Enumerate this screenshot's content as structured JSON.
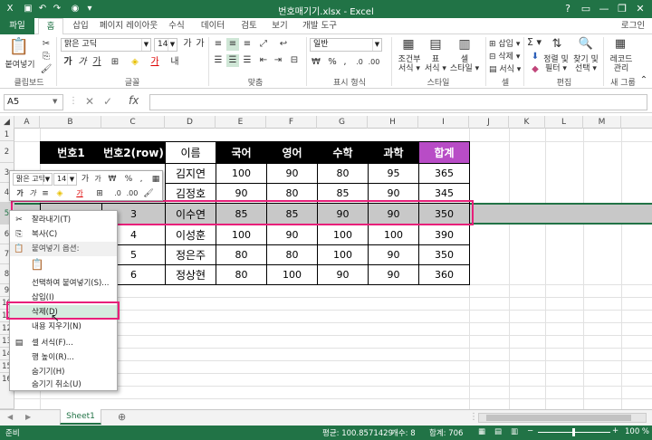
{
  "window": {
    "title": "번호매기기.xlsx - Excel",
    "user": "로그인"
  },
  "tabs": [
    "파일",
    "홈",
    "삽입",
    "페이지 레이아웃",
    "수식",
    "데이터",
    "검토",
    "보기",
    "개발 도구"
  ],
  "ribbon": {
    "paste": "붙여넣기",
    "font_name": "맑은 고딕",
    "font_size": "14",
    "number_format": "일반",
    "groups": {
      "clipboard": "클립보드",
      "font": "글꼴",
      "align": "맞춤",
      "number": "표시 형식",
      "style": "스타일",
      "cells": "셀",
      "edit": "편집",
      "newgroup": "새 그룹"
    },
    "cond_format": [
      "조건부",
      "서식 ▾"
    ],
    "table_format": [
      "표",
      "서식 ▾"
    ],
    "cell_style": [
      "셀",
      "스타일 ▾"
    ],
    "insert": "삽입 ▾",
    "delete": "삭제 ▾",
    "format": "서식 ▾",
    "sort": [
      "정렬 및",
      "필터 ▾"
    ],
    "find": [
      "찾기 및",
      "선택 ▾"
    ],
    "record": [
      "레코드",
      "관리"
    ],
    "sigma": "Σ ▾"
  },
  "formula_bar": {
    "name_box": "A5",
    "fx": "fx"
  },
  "columns": [
    "A",
    "B",
    "C",
    "D",
    "E",
    "F",
    "G",
    "H",
    "I",
    "J",
    "K",
    "L",
    "M"
  ],
  "rows": [
    "1",
    "2",
    "3",
    "4",
    "5",
    "6",
    "7",
    "8",
    "9",
    "10",
    "11",
    "12",
    "13",
    "14",
    "15",
    "16"
  ],
  "table": {
    "headers": [
      "번호1",
      "번호2(row)",
      "이름",
      "국어",
      "영어",
      "수학",
      "과학",
      "합계"
    ],
    "rows": [
      [
        "",
        "",
        "김지연",
        "100",
        "90",
        "80",
        "95",
        "365"
      ],
      [
        "",
        "",
        "김정호",
        "90",
        "80",
        "85",
        "90",
        "345"
      ],
      [
        "",
        "3",
        "이수연",
        "85",
        "85",
        "90",
        "90",
        "350"
      ],
      [
        "",
        "4",
        "이성훈",
        "100",
        "90",
        "100",
        "100",
        "390"
      ],
      [
        "",
        "5",
        "정은주",
        "80",
        "80",
        "100",
        "90",
        "350"
      ],
      [
        "",
        "6",
        "정상현",
        "80",
        "100",
        "90",
        "90",
        "360"
      ]
    ]
  },
  "mini_toolbar": {
    "font": "맑은 고딕",
    "size": "14"
  },
  "context_menu": [
    "잘라내기(T)",
    "복사(C)",
    "붙여넣기 옵션:",
    "",
    "선택하여 붙여넣기(S)...",
    "삽입(I)",
    "삭제(D)",
    "내용 지우기(N)",
    "셀 서식(F)...",
    "행 높이(R)...",
    "숨기기(H)",
    "숨기기 취소(U)"
  ],
  "sheet": {
    "name": "Sheet1"
  },
  "status": {
    "mode": "준비",
    "average": "평균: 100.8571429",
    "count": "개수: 8",
    "sum": "합계: 706",
    "zoom": "100 %"
  },
  "colors": {
    "excel_green": "#217346",
    "highlight": "#e8207a",
    "total_header": "#b84cc6"
  }
}
